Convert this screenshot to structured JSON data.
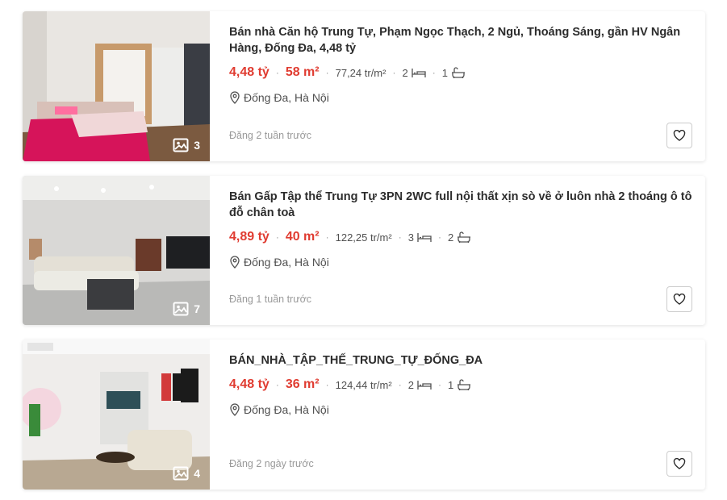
{
  "listings": [
    {
      "title": "Bán nhà Căn hộ Trung Tự, Phạm Ngọc Thạch, 2 Ngủ, Thoáng Sáng, gần HV Ngân Hàng, Đống Đa, 4,48 tỷ",
      "price": "4,48 tỷ",
      "area": "58 m²",
      "price_per_m2": "77,24 tr/m²",
      "bedrooms": "2",
      "bathrooms": "1",
      "location": "Đống Đa, Hà Nội",
      "posted": "Đăng 2 tuần trước",
      "photo_count": "3",
      "thumb_icon": "bedroom-photo"
    },
    {
      "title": "Bán Gấp Tập thể Trung Tự 3PN 2WC full nội thất xịn sò về ở luôn nhà 2 thoáng ô tô đỗ chân toà",
      "price": "4,89 tỷ",
      "area": "40 m²",
      "price_per_m2": "122,25 tr/m²",
      "bedrooms": "3",
      "bathrooms": "2",
      "location": "Đống Đa, Hà Nội",
      "posted": "Đăng 1 tuần trước",
      "photo_count": "7",
      "thumb_icon": "living-room-photo"
    },
    {
      "title": "BÁN_NHÀ_TẬP_THẾ_TRUNG_TỰ_ĐỐNG_ĐA",
      "price": "4,48 tỷ",
      "area": "36 m²",
      "price_per_m2": "124,44 tr/m²",
      "bedrooms": "2",
      "bathrooms": "1",
      "location": "Đống Đa, Hà Nội",
      "posted": "Đăng 2 ngày trước",
      "photo_count": "4",
      "thumb_icon": "apartment-photo"
    }
  ],
  "colors": {
    "price": "#e03c31",
    "muted": "#999999",
    "text": "#2c2c2c"
  }
}
